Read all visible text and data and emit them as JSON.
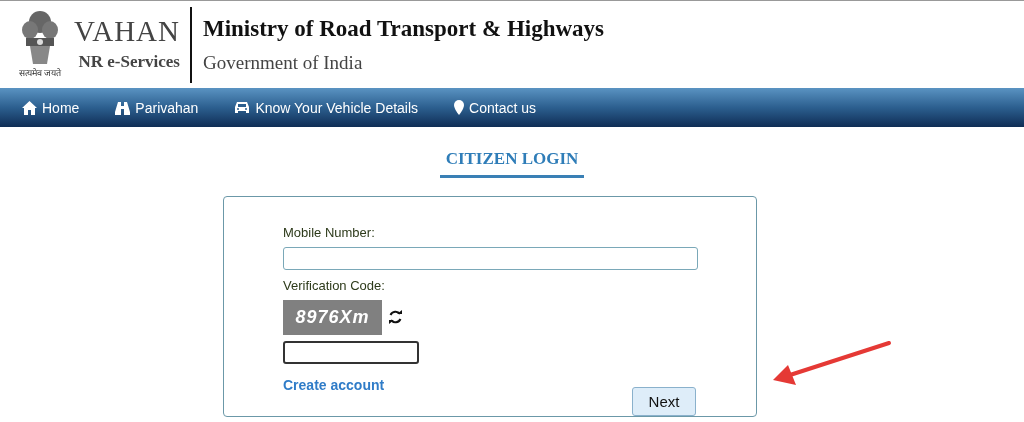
{
  "header": {
    "brand": "VAHAN",
    "brand_sub": "NR e-Services",
    "motto": "सत्यमेव जयते",
    "title": "Ministry of Road Transport & Highways",
    "subtitle": "Government of India"
  },
  "nav": [
    {
      "label": "Home"
    },
    {
      "label": "Parivahan"
    },
    {
      "label": "Know Your Vehicle Details"
    },
    {
      "label": "Contact us"
    }
  ],
  "heading": "CITIZEN LOGIN",
  "form": {
    "mobile_label": "Mobile Number:",
    "code_label": "Verification Code:",
    "captcha": "8976Xm",
    "create_link": "Create account",
    "next_button": "Next"
  }
}
